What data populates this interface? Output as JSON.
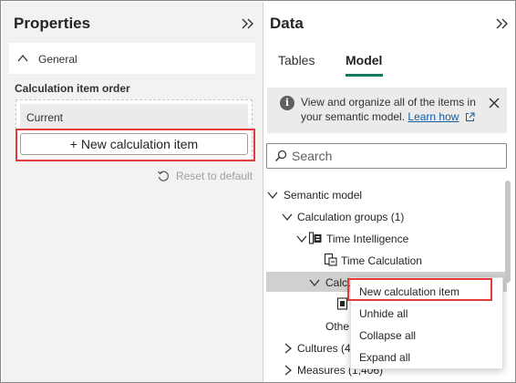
{
  "properties_pane": {
    "title": "Properties",
    "section_label": "General",
    "order_label": "Calculation item order",
    "current_item": "Current",
    "new_item_button": "+ New calculation item",
    "reset_label": "Reset to default"
  },
  "data_pane": {
    "title": "Data",
    "tabs": [
      {
        "label": "Tables",
        "active": false
      },
      {
        "label": "Model",
        "active": true
      }
    ],
    "info_banner": {
      "text": "View and organize all of the items in your semantic model.",
      "link": "Learn how"
    },
    "search_placeholder": "Search",
    "tree": {
      "semantic_model": "Semantic model",
      "calc_groups": "Calculation groups (1)",
      "time_intelligence": "Time Intelligence",
      "time_calculation": "Time Calculation",
      "calc_items_partial": "Calcu",
      "other_partial": "Othe",
      "cultures": "Cultures (4",
      "measures": "Measures (1,406)"
    }
  },
  "context_menu": {
    "items": [
      "New calculation item",
      "Unhide all",
      "Collapse all",
      "Expand all"
    ]
  },
  "colors": {
    "highlight": "#e23b3b",
    "tab_accent": "#117865",
    "link": "#115ea3"
  }
}
